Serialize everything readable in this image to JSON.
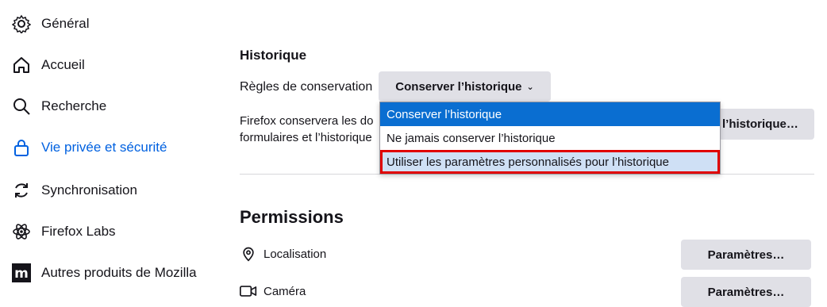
{
  "sidebar": {
    "items": [
      {
        "label": "Général",
        "icon": "gear-icon"
      },
      {
        "label": "Accueil",
        "icon": "home-icon"
      },
      {
        "label": "Recherche",
        "icon": "search-icon"
      },
      {
        "label": "Vie privée et sécurité",
        "icon": "lock-icon",
        "selected": true
      },
      {
        "label": "Synchronisation",
        "icon": "sync-icon"
      },
      {
        "label": "Firefox Labs",
        "icon": "atom-icon"
      },
      {
        "label": "Autres produits de Mozilla",
        "icon": "mozilla-logo-icon"
      }
    ]
  },
  "history": {
    "heading": "Historique",
    "retention_label": "Règles de conservation",
    "select_value": "Conserver l’historique",
    "description_line1": "Firefox conservera les do",
    "description_line2": "formulaires et l’historique",
    "clear_button_label": "l’historique…",
    "dropdown_options": [
      "Conserver l’historique",
      "Ne jamais conserver l’historique",
      "Utiliser les paramètres personnalisés pour l’historique"
    ]
  },
  "permissions": {
    "heading": "Permissions",
    "rows": [
      {
        "label": "Localisation",
        "icon": "location-pin-icon",
        "button": "Paramètres…"
      },
      {
        "label": "Caméra",
        "icon": "camera-icon",
        "button": "Paramètres…"
      }
    ]
  },
  "colors": {
    "accent": "#0061e0",
    "selected_option": "#0a6ed1",
    "highlight_border": "#e00000"
  }
}
